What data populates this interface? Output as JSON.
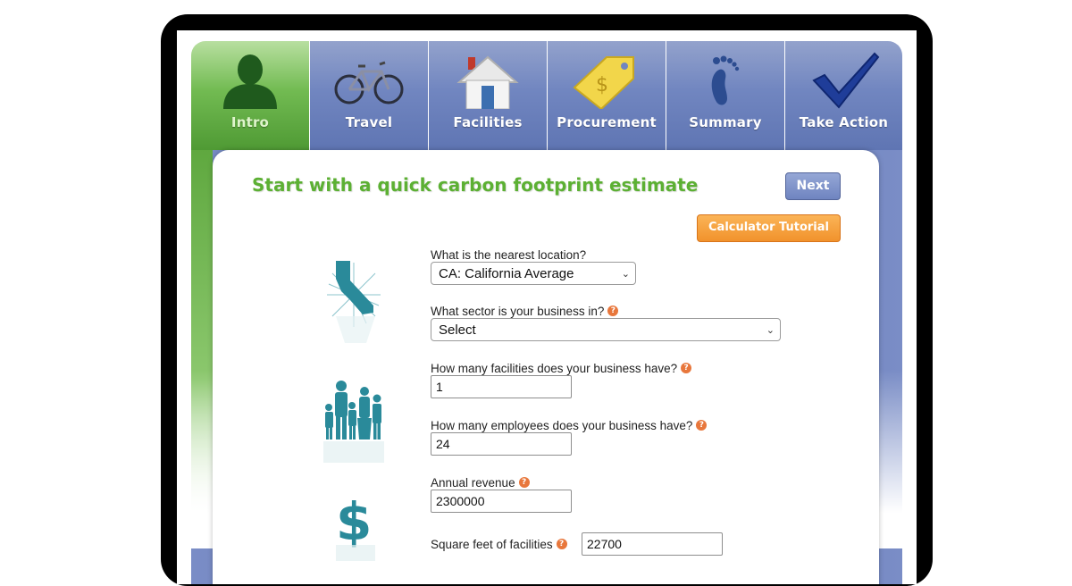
{
  "tabs": [
    {
      "label": "Intro",
      "icon": "person-silhouette-icon",
      "active": true
    },
    {
      "label": "Travel",
      "icon": "bicycle-icon",
      "active": false
    },
    {
      "label": "Facilities",
      "icon": "house-icon",
      "active": false
    },
    {
      "label": "Procurement",
      "icon": "price-tag-icon",
      "active": false
    },
    {
      "label": "Summary",
      "icon": "footprint-icon",
      "active": false
    },
    {
      "label": "Take Action",
      "icon": "checkmark-icon",
      "active": false
    }
  ],
  "page": {
    "title": "Start with a quick carbon footprint estimate",
    "next_label": "Next",
    "tutorial_label": "Calculator Tutorial"
  },
  "form": {
    "location_label": "What is the nearest location?",
    "location_value": "CA: California Average",
    "sector_label": "What sector is your business in?",
    "sector_value": "Select",
    "facilities_label": "How many facilities does your business have?",
    "facilities_value": "1",
    "employees_label": "How many employees does your business have?",
    "employees_value": "24",
    "revenue_label": "Annual revenue",
    "revenue_value": "2300000",
    "sqft_label": "Square feet of facilities",
    "sqft_value": "22700"
  },
  "colors": {
    "tab_blue": "#6f84c0",
    "tab_green": "#72bb52",
    "title_green": "#5cb033",
    "tutorial_orange": "#f1922c",
    "help_orange": "#e8773c",
    "illustration_teal": "#2a8a9a"
  }
}
